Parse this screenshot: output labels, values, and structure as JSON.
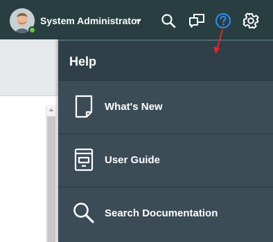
{
  "header": {
    "user_name": "System Administrator",
    "status_color": "#6cc24a",
    "icons": [
      "user-menu-caret",
      "search-icon",
      "chat-icon",
      "help-icon",
      "gear-icon"
    ]
  },
  "help_panel": {
    "title": "Help",
    "items": [
      {
        "label": "What's New",
        "icon": "document-icon"
      },
      {
        "label": "User Guide",
        "icon": "guide-icon"
      },
      {
        "label": "Search Documentation",
        "icon": "search-icon"
      }
    ]
  },
  "colors": {
    "header_bg": "#293e40",
    "panel_bg": "#3b4c57",
    "accent": "#2f8cff",
    "annotation": "#e3252b"
  }
}
